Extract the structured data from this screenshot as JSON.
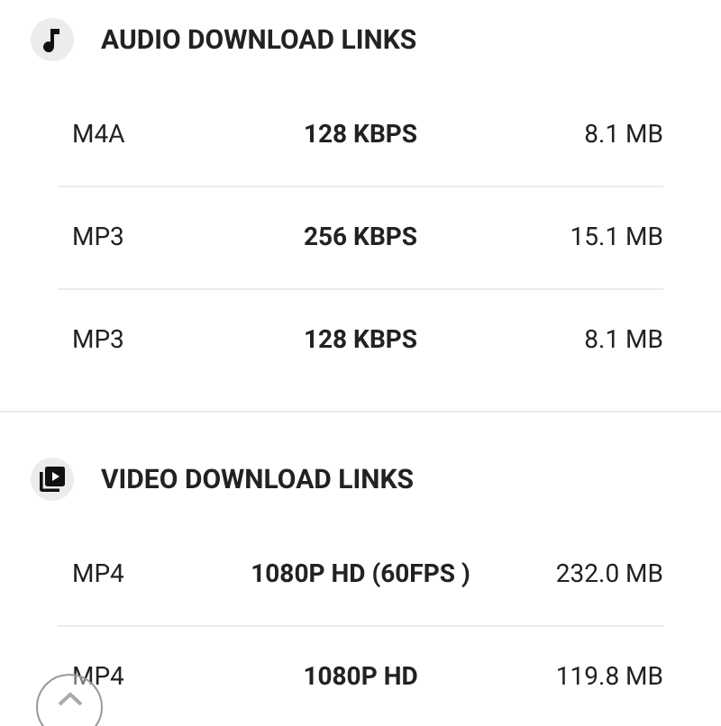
{
  "sections": [
    {
      "kind": "audio",
      "title": "AUDIO DOWNLOAD LINKS",
      "rows": [
        {
          "format": "M4A",
          "quality": "128 KBPS",
          "size": "8.1 MB"
        },
        {
          "format": "MP3",
          "quality": "256 KBPS",
          "size": "15.1 MB"
        },
        {
          "format": "MP3",
          "quality": "128 KBPS",
          "size": "8.1 MB"
        }
      ]
    },
    {
      "kind": "video",
      "title": "VIDEO DOWNLOAD LINKS",
      "rows": [
        {
          "format": "MP4",
          "quality": "1080P HD (60FPS )",
          "size": "232.0 MB"
        },
        {
          "format": "MP4",
          "quality": "1080P HD",
          "size": "119.8 MB"
        }
      ]
    }
  ]
}
